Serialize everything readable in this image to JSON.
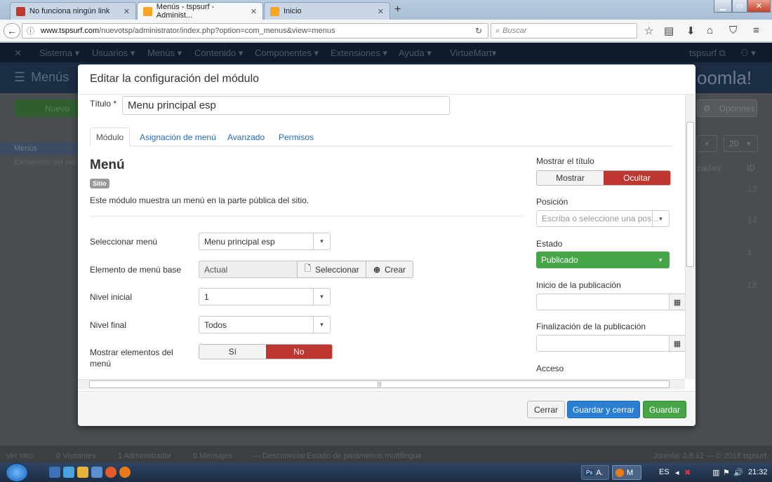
{
  "browser": {
    "tabs": [
      {
        "title": "No funciona ningún link",
        "color": "#c0392b"
      },
      {
        "title": "Menús - tspsurf - Administ...",
        "color": "#f7a51e"
      },
      {
        "title": "Inicio",
        "color": "#f7a51e"
      }
    ],
    "url_host": "www.tspsurf.com",
    "url_path": "/nuevotsp/administrator/index.php?option=com_menus&view=menus",
    "search_placeholder": "Buscar"
  },
  "joomla": {
    "menu": [
      "Sistema ▾",
      "Usuarios ▾",
      "Menús ▾",
      "Contenido ▾",
      "Componentes ▾",
      "Extensiones ▾",
      "Ayuda ▾",
      "VirtueMart▾"
    ],
    "user": "tspsurf ⧉",
    "page_title": "Menús",
    "logo": "oomla!",
    "new_btn": "Nuevo",
    "options_btn": "Opciones",
    "sidebar": [
      "Menús",
      "Elementos del me"
    ],
    "col_linked": "zados",
    "col_id": "ID",
    "limit": "20",
    "ids": [
      "13",
      "14",
      "1",
      "12"
    ],
    "status_left": [
      "Ver sitio",
      "0 Visitantes",
      "1 Administrador",
      "0 Mensajes",
      "— Desconectar",
      "Estado de parámetros multilingüe"
    ],
    "status_right": "Joomla! 3.8.12 — © 2018 tspsurf"
  },
  "modal": {
    "title": "Editar la configuración del módulo",
    "titulo_label": "Título *",
    "titulo_value": "Menu principal esp",
    "tabs": [
      "Módulo",
      "Asignación de menú",
      "Avanzado",
      "Permisos"
    ],
    "module_name": "Menú",
    "badge": "Sitio",
    "description": "Este módulo muestra un menú en la parte pública del sitio.",
    "fields": {
      "menu_label": "Seleccionar menú",
      "menu_value": "Menu principal esp",
      "base_label": "Elemento de menú base",
      "base_value": "Actual",
      "select_btn": "Seleccionar",
      "create_btn": "Crear",
      "start_label": "Nivel inicial",
      "start_value": "1",
      "end_label": "Nivel final",
      "end_value": "Todos",
      "sub_label_1": "Mostrar elementos del",
      "sub_label_2": "menú",
      "yes": "Sí",
      "no": "No"
    },
    "right": {
      "show_title_label": "Mostrar el título",
      "show": "Mostrar",
      "hide": "Ocultar",
      "position_label": "Posición",
      "position_placeholder": "Escriba o seleccione una pos...",
      "state_label": "Estado",
      "state_value": "Publicado",
      "publish_up_label": "Inicio de la publicación",
      "publish_down_label": "Finalización de la publicación",
      "access_label": "Acceso"
    },
    "footer": {
      "close": "Cerrar",
      "save_close": "Guardar y cerrar",
      "save": "Guardar"
    }
  },
  "taskbar": {
    "apps": [
      "A.",
      "M"
    ],
    "lang": "ES",
    "time": "21:32"
  },
  "colors": {
    "primary": "#2a7fd4",
    "success": "#46a546",
    "danger": "#bd362f"
  }
}
